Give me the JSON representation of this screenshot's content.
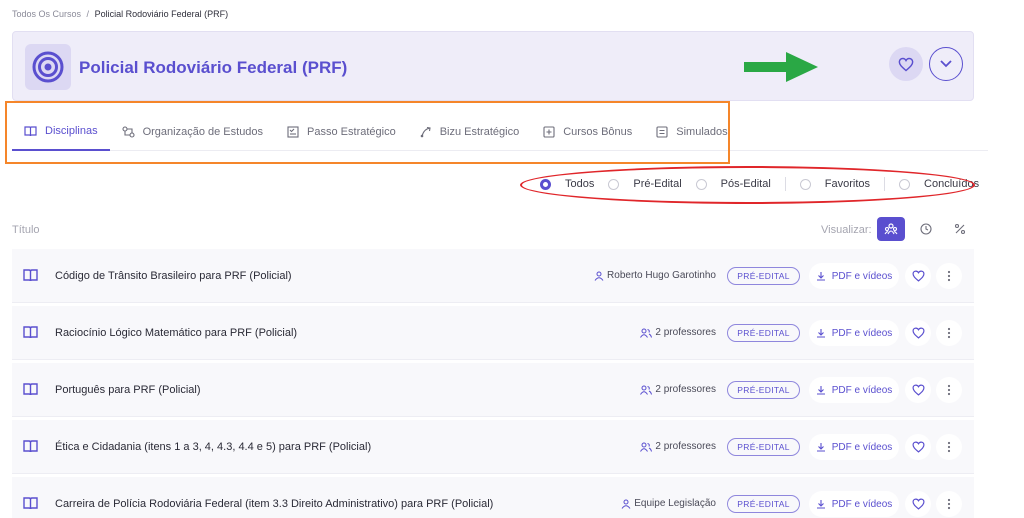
{
  "breadcrumb": {
    "root": "Todos Os Cursos",
    "separator": "/",
    "current": "Policial Rodoviário Federal (PRF)"
  },
  "course": {
    "title": "Policial Rodoviário Federal (PRF)",
    "icon": "target-icon"
  },
  "tabs": [
    {
      "label": "Disciplinas",
      "icon": "book-icon",
      "active": true
    },
    {
      "label": "Organização de Estudos",
      "icon": "route-icon"
    },
    {
      "label": "Passo Estratégico",
      "icon": "checklist-icon"
    },
    {
      "label": "Bizu Estratégico",
      "icon": "trend-icon"
    },
    {
      "label": "Cursos Bônus",
      "icon": "plus-square-icon"
    },
    {
      "label": "Simulados",
      "icon": "document-icon"
    }
  ],
  "filters": [
    {
      "label": "Todos",
      "checked": true
    },
    {
      "label": "Pré-Edital"
    },
    {
      "label": "Pós-Edital"
    },
    {
      "label": "Favoritos"
    },
    {
      "label": "Concluídos"
    }
  ],
  "list": {
    "column_title": "Título",
    "visualize_label": "Visualizar:",
    "rows": [
      {
        "title": "Código de Trânsito Brasileiro para PRF (Policial)",
        "professor": "Roberto Hugo Garotinho",
        "prof_icon": "user-icon",
        "badge": "PRÉ-EDITAL",
        "action": "PDF e vídeos"
      },
      {
        "title": "Raciocínio Lógico Matemático para PRF (Policial)",
        "professor": "2 professores",
        "prof_icon": "users-icon",
        "badge": "PRÉ-EDITAL",
        "action": "PDF e vídeos"
      },
      {
        "title": "Português para PRF (Policial)",
        "professor": "2 professores",
        "prof_icon": "users-icon",
        "badge": "PRÉ-EDITAL",
        "action": "PDF e vídeos"
      },
      {
        "title": "Ética e Cidadania (itens 1 a 3, 4, 4.3, 4.4 e 5) para PRF (Policial)",
        "professor": "2 professores",
        "prof_icon": "users-icon",
        "badge": "PRÉ-EDITAL",
        "action": "PDF e vídeos"
      },
      {
        "title": "Carreira de Polícia Rodoviária Federal (item 3.3 Direito Administrativo) para PRF (Policial)",
        "professor": "Equipe Legislação",
        "prof_icon": "user-icon",
        "badge": "PRÉ-EDITAL",
        "action": "PDF e vídeos"
      }
    ]
  },
  "colors": {
    "accent": "#5a4fcf",
    "header_bg": "#efedf9",
    "annotation_orange": "#f5862a",
    "annotation_red": "#e0262a",
    "annotation_green": "#2aa845"
  }
}
